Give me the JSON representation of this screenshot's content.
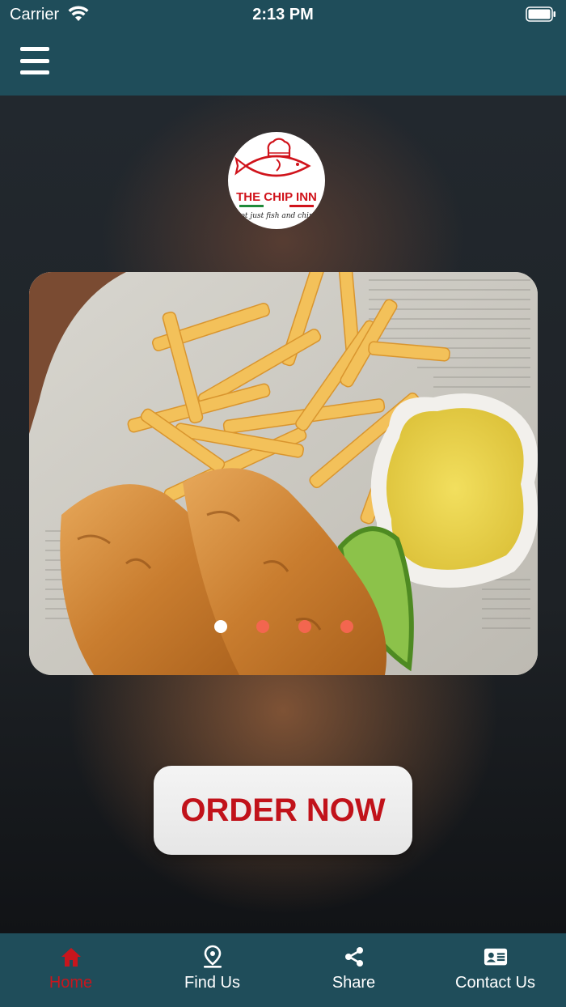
{
  "status_bar": {
    "carrier": "Carrier",
    "time": "2:13 PM"
  },
  "header": {
    "menu_icon": "hamburger-menu-icon"
  },
  "logo": {
    "brand_text": "THE CHIP INN",
    "tagline": "not just fish and chips"
  },
  "carousel": {
    "slide_count": 4,
    "active_index": 0,
    "dot_active_color": "#ffffff",
    "dot_inactive_color": "#f3664f"
  },
  "order_button": {
    "label": "ORDER NOW",
    "text_color": "#c1121a"
  },
  "tabbar": {
    "active_color": "#c8161d",
    "tabs": [
      {
        "label": "Home",
        "icon": "home-icon",
        "active": true
      },
      {
        "label": "Find Us",
        "icon": "map-pin-icon",
        "active": false
      },
      {
        "label": "Share",
        "icon": "share-icon",
        "active": false
      },
      {
        "label": "Contact Us",
        "icon": "contact-card-icon",
        "active": false
      }
    ]
  },
  "colors": {
    "header_bg": "#1f4d5a",
    "tabbar_bg": "#1f4d5a"
  }
}
